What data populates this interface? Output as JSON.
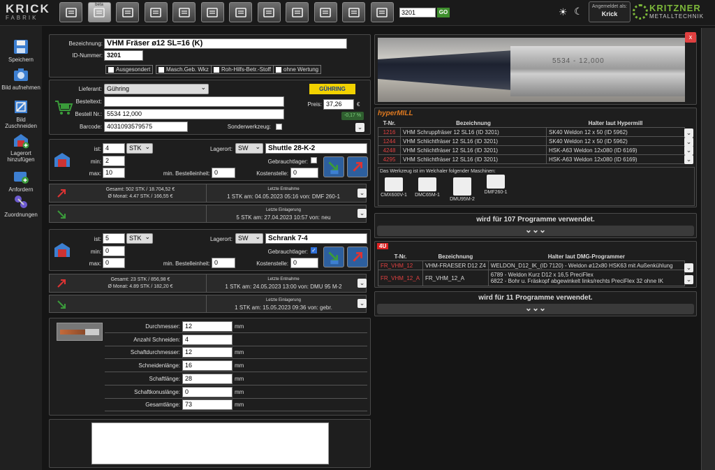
{
  "app": {
    "logo_top": "KRICK",
    "logo_bottom": "FABRIK",
    "beta": "beta"
  },
  "topbar": {
    "search_value": "3201",
    "go_label": "GO",
    "login_label": "Angemeldet als:",
    "login_user": "Krick",
    "brand_main": "KRITZNER",
    "brand_sub": "METALLTECHNIK"
  },
  "sidebar": {
    "items": [
      {
        "label": "Speichern"
      },
      {
        "label": "Bild aufnehmen"
      },
      {
        "label": "Bild Zuschneiden"
      },
      {
        "label": "Lagerort hinzufügen"
      },
      {
        "label": "Anfordern"
      },
      {
        "label": "Zuordnungen"
      }
    ]
  },
  "article": {
    "bezeichnung_label": "Bezeichnung:",
    "bezeichnung": "VHM Fräser ø12 SL=16 (K)",
    "id_label": "ID-Nummer:",
    "id": "3201",
    "checks": [
      "Ausgesondert",
      "Masch.Geb. Wkz",
      "Roh-Hilfs-Betr.-Stoff",
      "ohne Wertung"
    ]
  },
  "supplier": {
    "lieferant_label": "Lieferant:",
    "lieferant": "Gühring",
    "bestelltext_label": "Besteltext:",
    "bestelltext": "",
    "bestellnr_label": "Bestell Nr.:",
    "bestellnr": "5534 12,000",
    "barcode_label": "Barcode:",
    "barcode": "4031093579575",
    "sonder_label": "Sonderwerkzeug:",
    "preis_label": "Preis:",
    "preis": "37,26",
    "currency": "€",
    "change": "-0,17 %",
    "logo_text": "GÜHRING"
  },
  "stock1": {
    "ist_label": "ist:",
    "ist": "4",
    "unit": "STK",
    "min_label": "min:",
    "min": "2",
    "max_label": "max:",
    "max": "10",
    "lagerort_label": "Lagerort:",
    "lager_sel": "SW",
    "lagerort": "Shuttle 28-K-2",
    "gebraucht_label": "Gebrauchtlager:",
    "gebraucht": false,
    "minbest_label": "min. Bestelleinheit:",
    "minbest": "0",
    "kosten_label": "Kostenstelle:",
    "kosten": "0",
    "stats": {
      "gesamt": "Gesamt: 502 STK / 18.704,52 €",
      "monat": "Ø Monat: 4.47 STK / 166,55 €",
      "entnahme_title": "Letzte Entnahme",
      "entnahme": "1 STK am: 04.05.2023 05:16 von: DMF 260-1",
      "einlagerung_title": "Letzte Einlagerung",
      "einlagerung": "5 STK am: 27.04.2023 10:57 von: neu"
    }
  },
  "stock2": {
    "ist_label": "ist:",
    "ist": "5",
    "unit": "STK",
    "min_label": "min:",
    "min": "0",
    "max_label": "max:",
    "max": "0",
    "lagerort_label": "Lagerort:",
    "lager_sel": "SW",
    "lagerort": "Schrank 7-4",
    "gebraucht_label": "Gebrauchtlager:",
    "gebraucht": true,
    "minbest_label": "min. Bestelleinheit:",
    "minbest": "0",
    "kosten_label": "Kostenstelle:",
    "kosten": "0",
    "stats": {
      "gesamt": "Gesamt: 23 STK / 856,98 €",
      "monat": "Ø Monat: 4.89 STK / 182,20 €",
      "entnahme_title": "Letzte Entnahme",
      "entnahme": "1 STK am: 24.05.2023 13:00 von: DMU 95 M-2",
      "einlagerung_title": "Letzte Einlagerung",
      "einlagerung": "1 STK am: 15.05.2023 09:36 von: gebr."
    }
  },
  "specs": [
    {
      "label": "Durchmesser:",
      "value": "12",
      "unit": "mm"
    },
    {
      "label": "Anzahl Schneiden:",
      "value": "4",
      "unit": ""
    },
    {
      "label": "Schaftdurchmesser:",
      "value": "12",
      "unit": "mm"
    },
    {
      "label": "Schneidenlänge:",
      "value": "16",
      "unit": "mm"
    },
    {
      "label": "Schaftlänge:",
      "value": "28",
      "unit": "mm"
    },
    {
      "label": "Schaftkonuslänge:",
      "value": "0",
      "unit": "mm"
    },
    {
      "label": "Gesamtlänge:",
      "value": "73",
      "unit": "mm"
    }
  ],
  "hypermill": {
    "logo": "hyperMILL",
    "headers": [
      "T-Nr.",
      "Bezeichnung",
      "Halter laut Hypermill"
    ],
    "rows": [
      [
        "1216",
        "VHM Schruppfräser 12 SL16 (ID 3201)",
        "SK40 Weldon 12 x 50 (ID 5962)"
      ],
      [
        "1244",
        "VHM Schlichtfräser 12 SL16 (ID 3201)",
        "SK40 Weldon 12 x 50 (ID 5962)"
      ],
      [
        "4248",
        "VHM Schlichtfräser 12 SL16 (ID 3201)",
        "HSK-A63 Weldon 12x080 (ID 6169)"
      ],
      [
        "4295",
        "VHM Schlichtfräser 12 SL16 (ID 3201)",
        "HSK-A63 Weldon 12x080 (ID 6169)"
      ]
    ],
    "machines_title": "Das Werkzeug ist im Welchaler folgender Maschinen:",
    "machines": [
      "CMX600V-1",
      "DMC65M-1",
      "DMU95M-2",
      "DMF260-1"
    ],
    "used": "wird für 107 Programme verwendet."
  },
  "dmg": {
    "logo": "4U",
    "headers": [
      "T-Nr.",
      "Bezeichnung",
      "Halter laut DMG-Programmer"
    ],
    "rows": [
      [
        "FR_VHM_12",
        "VHM-FRAESER D12 Z4",
        "WELDON_D12_IK_(ID 7120) - Weldon ø12x80 HSK63 mit Außenkühlung"
      ],
      [
        "FR_VHM_12_A",
        "FR_VHM_12_A",
        "6789 - Weldon Kurz D12 x 16,5 PreciFlex",
        "6822 - Bohr u. Fräskopf abgewinkelt links/rechts PreciFlex 32 ohne IK"
      ]
    ],
    "used": "wird für 11 Programme verwendet."
  },
  "photo": {
    "close": "x",
    "shank_text": "5534 - 12,000"
  }
}
